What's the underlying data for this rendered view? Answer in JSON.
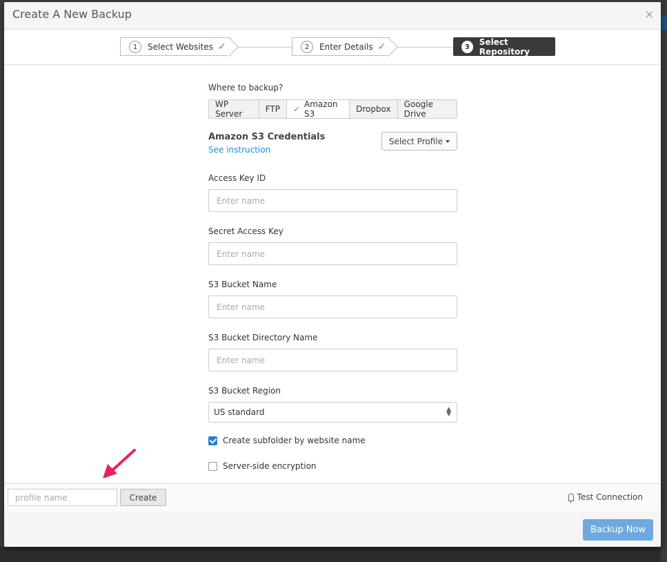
{
  "modal": {
    "title": "Create A New Backup",
    "close_glyph": "×"
  },
  "steps": [
    {
      "number": "1",
      "label": "Select Websites",
      "completed": true
    },
    {
      "number": "2",
      "label": "Enter Details",
      "completed": true
    },
    {
      "number": "3",
      "label": "Select Repository",
      "active": true
    }
  ],
  "step_check_glyph": "✓",
  "where_label": "Where to backup?",
  "destinations": [
    {
      "label": "WP Server"
    },
    {
      "label": "FTP"
    },
    {
      "label": "Amazon S3",
      "selected": true
    },
    {
      "label": "Dropbox"
    },
    {
      "label": "Google Drive"
    }
  ],
  "credentials": {
    "title": "Amazon S3 Credentials",
    "link": "See instruction",
    "select_profile": "Select Profile"
  },
  "fields": {
    "access_key": {
      "label": "Access Key ID",
      "placeholder": "Enter name"
    },
    "secret_key": {
      "label": "Secret Access Key",
      "placeholder": "Enter name"
    },
    "bucket_name": {
      "label": "S3 Bucket Name",
      "placeholder": "Enter name"
    },
    "bucket_dir": {
      "label": "S3 Bucket Directory Name",
      "placeholder": "Enter name"
    },
    "region": {
      "label": "S3 Bucket Region",
      "value": "US standard"
    }
  },
  "options": {
    "subfolder": {
      "label": "Create subfolder by website name",
      "checked": true
    },
    "encryption": {
      "label": "Server-side encryption",
      "checked": false
    }
  },
  "footer": {
    "profile_placeholder": "profile name",
    "create_label": "Create",
    "test_connection_label": "Test Connection",
    "backup_now_label": "Backup Now"
  },
  "colors": {
    "accent_blue": "#2a7ed8",
    "check_green": "#3cb043",
    "backup_button": "#6ea8de",
    "arrow": "#e8235f",
    "active_step": "#3a3a3a"
  },
  "icons": {
    "close": "close-icon",
    "check": "check-icon",
    "caret": "caret-down-icon",
    "updown": "updown-icon",
    "plug": "plug-icon",
    "annotation": "pointer-arrow-icon"
  }
}
